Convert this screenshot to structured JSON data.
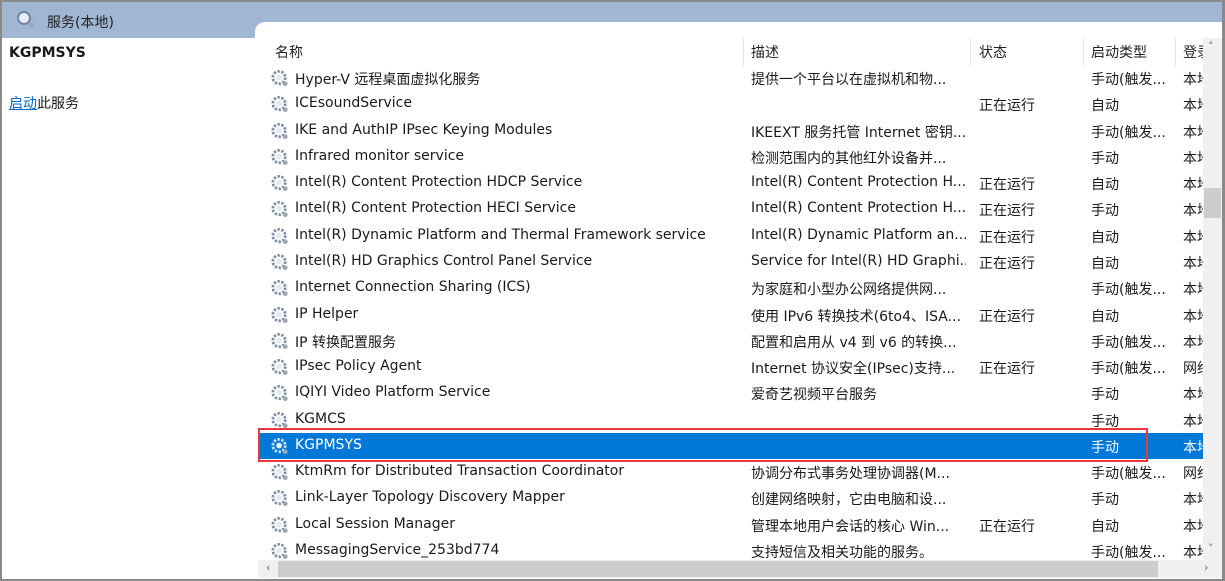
{
  "window": {
    "title": "服务(本地)",
    "title_icon": "services-gear-magnifier-icon"
  },
  "left_panel": {
    "service_name": "KGPMSYS",
    "start_link": "启动",
    "start_suffix": "此服务"
  },
  "columns": [
    "名称",
    "描述",
    "状态",
    "启动类型",
    "登录为"
  ],
  "rows": [
    {
      "name": "Hyper-V 远程桌面虚拟化服务",
      "desc": "提供一个平台以在虚拟机和物...",
      "status": "",
      "startup": "手动(触发...",
      "logon": "本地"
    },
    {
      "name": "ICEsoundService",
      "desc": "",
      "status": "正在运行",
      "startup": "自动",
      "logon": "本地"
    },
    {
      "name": "IKE and AuthIP IPsec Keying Modules",
      "desc": "IKEEXT 服务托管 Internet 密钥...",
      "status": "",
      "startup": "手动(触发...",
      "logon": "本地"
    },
    {
      "name": "Infrared monitor service",
      "desc": "检测范围内的其他红外设备并...",
      "status": "",
      "startup": "手动",
      "logon": "本地"
    },
    {
      "name": "Intel(R) Content Protection HDCP Service",
      "desc": "Intel(R) Content Protection H...",
      "status": "正在运行",
      "startup": "自动",
      "logon": "本地"
    },
    {
      "name": "Intel(R) Content Protection HECI Service",
      "desc": "Intel(R) Content Protection H...",
      "status": "正在运行",
      "startup": "手动",
      "logon": "本地"
    },
    {
      "name": "Intel(R) Dynamic Platform and Thermal Framework service",
      "desc": "Intel(R) Dynamic Platform an...",
      "status": "正在运行",
      "startup": "自动",
      "logon": "本地"
    },
    {
      "name": "Intel(R) HD Graphics Control Panel Service",
      "desc": "Service for Intel(R) HD Graphi...",
      "status": "正在运行",
      "startup": "自动",
      "logon": "本地"
    },
    {
      "name": "Internet Connection Sharing (ICS)",
      "desc": "为家庭和小型办公网络提供网...",
      "status": "",
      "startup": "手动(触发...",
      "logon": "本地"
    },
    {
      "name": "IP Helper",
      "desc": "使用 IPv6 转换技术(6to4、ISA...",
      "status": "正在运行",
      "startup": "自动",
      "logon": "本地"
    },
    {
      "name": "IP 转换配置服务",
      "desc": "配置和启用从 v4 到 v6 的转换...",
      "status": "",
      "startup": "手动(触发...",
      "logon": "本地"
    },
    {
      "name": "IPsec Policy Agent",
      "desc": "Internet 协议安全(IPsec)支持...",
      "status": "正在运行",
      "startup": "手动(触发...",
      "logon": "网络"
    },
    {
      "name": "IQIYI Video Platform Service",
      "desc": "爱奇艺视频平台服务",
      "status": "",
      "startup": "手动",
      "logon": "本地"
    },
    {
      "name": "KGMCS",
      "desc": "",
      "status": "",
      "startup": "手动",
      "logon": "本地"
    },
    {
      "name": "KGPMSYS",
      "desc": "",
      "status": "",
      "startup": "手动",
      "logon": "本地",
      "selected": true
    },
    {
      "name": "KtmRm for Distributed Transaction Coordinator",
      "desc": "协调分布式事务处理协调器(M...",
      "status": "",
      "startup": "手动(触发...",
      "logon": "网络"
    },
    {
      "name": "Link-Layer Topology Discovery Mapper",
      "desc": "创建网络映射，它由电脑和设...",
      "status": "",
      "startup": "手动",
      "logon": "本地"
    },
    {
      "name": "Local Session Manager",
      "desc": "管理本地用户会话的核心 Win...",
      "status": "正在运行",
      "startup": "自动",
      "logon": "本地"
    },
    {
      "name": "MessagingService_253bd774",
      "desc": "支持短信及相关功能的服务。",
      "status": "",
      "startup": "手动(触发...",
      "logon": "本地"
    }
  ],
  "colors": {
    "selection": "#0078d7",
    "highlight_box": "#e8383d",
    "titlebar": "#9fb7d3",
    "link": "#0066cc"
  }
}
